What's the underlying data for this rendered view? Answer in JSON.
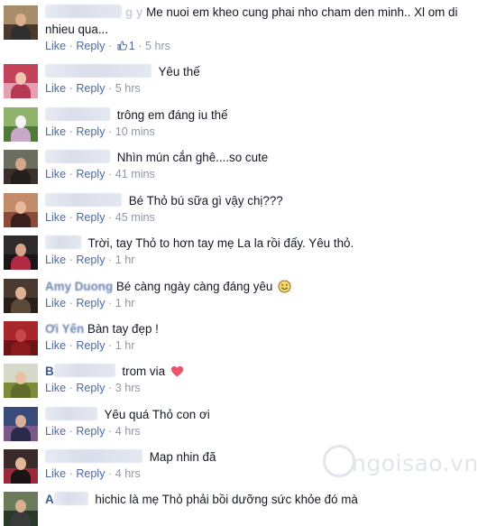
{
  "actions": {
    "like": "Like",
    "reply": "Reply"
  },
  "comments": [
    {
      "avatar": {
        "sky": "#a88d6a",
        "ground": "#4b3a2c",
        "face": "#d8b08c",
        "body": "#2f2f2f"
      },
      "name_text": "g y",
      "blur_w": 85,
      "text": "Me nuoi em kheo cung phai nho cham den minh.. Xl om di nhieu qua...",
      "likes": "1",
      "time": "5 hrs"
    },
    {
      "avatar": {
        "sky": "#c4435b",
        "ground": "#e5a0b0",
        "face": "#f1c5b0",
        "body": "#b63a53"
      },
      "name_text": "",
      "blur_w": 118,
      "text": "Yêu thế",
      "time": "5 hrs"
    },
    {
      "avatar": {
        "sky": "#8fb36b",
        "ground": "#4f7a3a",
        "face": "#f5f3f5",
        "body": "#c9a8c7"
      },
      "name_text": "",
      "blur_w": 72,
      "text": "trông em đáng iu thế",
      "time": "10 mins"
    },
    {
      "avatar": {
        "sky": "#6b6d5e",
        "ground": "#3a2f2a",
        "face": "#d4a68a",
        "body": "#23201e"
      },
      "name_text": "",
      "blur_w": 72,
      "text": "Nhìn mún cắn ghê....so cute",
      "time": "41 mins"
    },
    {
      "avatar": {
        "sky": "#c28b6a",
        "ground": "#8c4a3a",
        "face": "#e7b89a",
        "body": "#3a201c"
      },
      "name_text": "",
      "blur_w": 85,
      "text": "Bé Thỏ bú sữa gì vậy chị???",
      "time": "45 mins"
    },
    {
      "avatar": {
        "sky": "#2f2a2b",
        "ground": "#1a1516",
        "face": "#d6a48a",
        "body": "#b02a44"
      },
      "name_text": "",
      "blur_w": 40,
      "text": "Trời, tay Thỏ to hơn tay mẹ La la rồi đấy. Yêu thỏ.",
      "time": "1 hr"
    },
    {
      "avatar": {
        "sky": "#4a3a2f",
        "ground": "#2a1f1a",
        "face": "#e0b194",
        "body": "#5a4a3a"
      },
      "name_text": "Amy Duong",
      "blur_w": 0,
      "text": "Bé càng ngày càng đáng yêu",
      "emoji": "smile",
      "time": "1 hr"
    },
    {
      "avatar": {
        "sky": "#a8272a",
        "ground": "#6e1416",
        "face": "#c9464a",
        "body": "#8a1a1e"
      },
      "name_text": "Ơi Yến",
      "blur_w": 0,
      "text": "Bàn tay đẹp !",
      "time": "1 hr"
    },
    {
      "avatar": {
        "sky": "#d6d8c9",
        "ground": "#7c8a3a",
        "face": "#e6c2a2",
        "body": "#5f6b2a"
      },
      "name_text": "B",
      "blur_w": 68,
      "text": "trom via",
      "emoji": "heart",
      "time": "3 hrs"
    },
    {
      "avatar": {
        "sky": "#3a4a7a",
        "ground": "#7a5a8a",
        "face": "#d8b09a",
        "body": "#2a2a4a"
      },
      "name_text": "",
      "blur_w": 58,
      "text": "Yêu quá Thỏ con ơi",
      "time": "4 hrs"
    },
    {
      "avatar": {
        "sky": "#3a2a2a",
        "ground": "#9a2a3a",
        "face": "#e2b698",
        "body": "#1a1414"
      },
      "name_text": "",
      "blur_w": 108,
      "text": "Map nhin đã",
      "time": "4 hrs"
    },
    {
      "avatar": {
        "sky": "#6a7a5a",
        "ground": "#2a3a2a",
        "face": "#d8b090",
        "body": "#3a3a3a"
      },
      "name_text": "A",
      "blur_w": 38,
      "text": "hichic là mẹ Thỏ phải bồi dưỡng sức khỏe đó mà",
      "time": ""
    }
  ],
  "watermark": "ngoisao.vn"
}
